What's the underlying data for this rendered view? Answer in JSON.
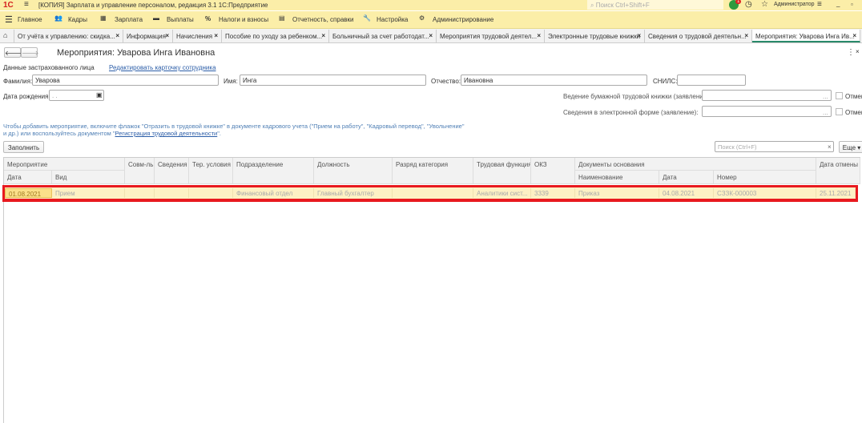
{
  "window": {
    "title": "[КОПИЯ] Зарплата и управление персоналом, редакция 3.1 1С:Предприятие",
    "search_placeholder": "Поиск Ctrl+Shift+F",
    "user": "Администратор",
    "notifications": "1"
  },
  "menu": [
    "Главное",
    "Кадры",
    "Зарплата",
    "Выплаты",
    "Налоги и взносы",
    "Отчетность, справки",
    "Настройка",
    "Администрирование"
  ],
  "tabs": [
    "От учёта к управлению: скидка...",
    "Информация",
    "Начисления",
    "Пособие по уходу за ребенком...",
    "Больничный за счет работодат...",
    "Мероприятия трудовой деятел...",
    "Электронные трудовые книжки",
    "Сведения о трудовой деятельн...",
    "Мероприятия: Уварова Инга Ив..."
  ],
  "form": {
    "title": "Мероприятия: Уварова Инга Ивановна",
    "section": "Данные застрахованного лица",
    "edit_link": "Редактировать карточку сотрудника",
    "surname_label": "Фамилия:",
    "surname": "Уварова",
    "name_label": "Имя:",
    "name": "Инга",
    "patronymic_label": "Отчество:",
    "patronymic": "Ивановна",
    "snils_label": "СНИЛС:",
    "snils": "",
    "birth_label": "Дата рождения:",
    "birth": " .  .",
    "paper_label": "Ведение бумажной трудовой книжки (заявление):",
    "electronic_label": "Сведения в электронной форме (заявление):",
    "cancel_label": "Отмен",
    "info1": "Чтобы добавить мероприятие, включите флажок \"Отразить в трудовой книжке\" в документе кадрового учета (\"Прием на работу\", \"Кадровый перевод\", \"Увольнение\"",
    "info2": "и др.) или воспользуйтесь документом \"",
    "info_link": "Регистрация трудовой деятельности",
    "info3": "\".",
    "fill_button": "Заполнить",
    "search_placeholder": "Поиск (Ctrl+F)",
    "more_button": "Еще"
  },
  "table": {
    "headers": {
      "event": "Мероприятие",
      "date": "Дата",
      "kind": "Вид",
      "combo": "Совм-ль",
      "info": "Сведения",
      "terr": "Тер. условия",
      "dept": "Подразделение",
      "position": "Должность",
      "grade": "Разряд категория",
      "function": "Трудовая функция",
      "okz": "ОКЗ",
      "docs": "Документы основания",
      "doc_name": "Наименование",
      "doc_date": "Дата",
      "doc_num": "Номер",
      "cancel_date": "Дата отмены"
    },
    "rows": [
      {
        "date": "01.08.2021",
        "kind": "Прием",
        "combo": "",
        "info": "",
        "terr": "",
        "dept": "Финансовый отдел",
        "position": "Главный бухгалтер",
        "grade": "",
        "function": "Аналитики сист...",
        "okz": "3339",
        "doc_name": "Приказ",
        "doc_date": "04.08.2021",
        "doc_num": "СЗЗК-000003",
        "cancel_date": "25.11.2021"
      }
    ]
  }
}
